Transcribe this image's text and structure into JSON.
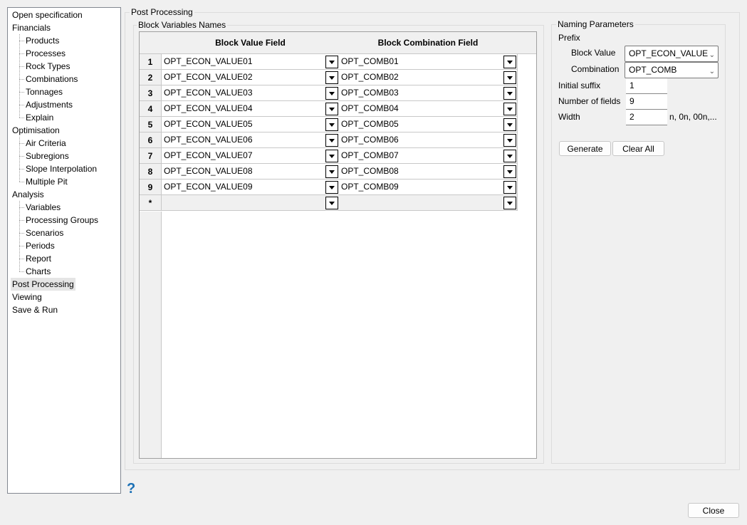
{
  "sidebar": {
    "items": [
      {
        "label": "Open specification",
        "level": 0
      },
      {
        "label": "Financials",
        "level": 0
      },
      {
        "label": "Products",
        "level": 1
      },
      {
        "label": "Processes",
        "level": 1
      },
      {
        "label": "Rock Types",
        "level": 1
      },
      {
        "label": "Combinations",
        "level": 1
      },
      {
        "label": "Tonnages",
        "level": 1
      },
      {
        "label": "Adjustments",
        "level": 1
      },
      {
        "label": "Explain",
        "level": 1
      },
      {
        "label": "Optimisation",
        "level": 0
      },
      {
        "label": "Air Criteria",
        "level": 1
      },
      {
        "label": "Subregions",
        "level": 1
      },
      {
        "label": "Slope Interpolation",
        "level": 1
      },
      {
        "label": "Multiple Pit",
        "level": 1
      },
      {
        "label": "Analysis",
        "level": 0
      },
      {
        "label": "Variables",
        "level": 1
      },
      {
        "label": "Processing Groups",
        "level": 1
      },
      {
        "label": "Scenarios",
        "level": 1
      },
      {
        "label": "Periods",
        "level": 1
      },
      {
        "label": "Report",
        "level": 1
      },
      {
        "label": "Charts",
        "level": 1
      },
      {
        "label": "Post Processing",
        "level": 0,
        "selected": true
      },
      {
        "label": "Viewing",
        "level": 0
      },
      {
        "label": "Save & Run",
        "level": 0
      }
    ]
  },
  "main": {
    "group_title": "Post Processing",
    "block_group_title": "Block Variables Names",
    "table": {
      "columns": [
        "Block Value Field",
        "Block Combination Field"
      ],
      "rows": [
        {
          "num": "1",
          "value": "OPT_ECON_VALUE01",
          "comb": "OPT_COMB01"
        },
        {
          "num": "2",
          "value": "OPT_ECON_VALUE02",
          "comb": "OPT_COMB02"
        },
        {
          "num": "3",
          "value": "OPT_ECON_VALUE03",
          "comb": "OPT_COMB03"
        },
        {
          "num": "4",
          "value": "OPT_ECON_VALUE04",
          "comb": "OPT_COMB04"
        },
        {
          "num": "5",
          "value": "OPT_ECON_VALUE05",
          "comb": "OPT_COMB05"
        },
        {
          "num": "6",
          "value": "OPT_ECON_VALUE06",
          "comb": "OPT_COMB06"
        },
        {
          "num": "7",
          "value": "OPT_ECON_VALUE07",
          "comb": "OPT_COMB07"
        },
        {
          "num": "8",
          "value": "OPT_ECON_VALUE08",
          "comb": "OPT_COMB08"
        },
        {
          "num": "9",
          "value": "OPT_ECON_VALUE09",
          "comb": "OPT_COMB09"
        },
        {
          "num": "*",
          "value": "",
          "comb": ""
        }
      ]
    },
    "naming": {
      "title": "Naming Parameters",
      "prefix_label": "Prefix",
      "block_value_label": "Block Value",
      "block_value": "OPT_ECON_VALUE",
      "combination_label": "Combination",
      "combination": "OPT_COMB",
      "initial_suffix_label": "Initial suffix",
      "initial_suffix": "1",
      "num_fields_label": "Number of fields",
      "num_fields": "9",
      "width_label": "Width",
      "width": "2",
      "width_hint": "n, 0n, 00n,...",
      "generate": "Generate",
      "clear_all": "Clear All"
    }
  },
  "footer": {
    "help": "?",
    "close": "Close"
  },
  "colors": {
    "help": "#1a6fb5"
  }
}
